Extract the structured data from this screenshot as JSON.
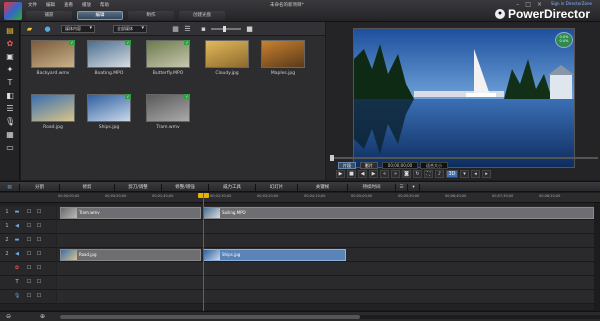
{
  "window": {
    "title": "未命名的新项目*",
    "menu": [
      "文件",
      "编辑",
      "查看",
      "播放",
      "帮助"
    ],
    "brand": "PowerDirector",
    "director_zone": "Sign in DirectorZone",
    "tabs": [
      "捕获",
      "编辑",
      "制作",
      "创建光盘"
    ],
    "active_tab": "编辑"
  },
  "library": {
    "filter_dropdown": "媒体内容",
    "sort_dropdown": "全部媒体",
    "items": [
      {
        "label": "Backyard.wmv",
        "colors": [
          "#7a5a3a",
          "#c9b28a"
        ],
        "checked": true
      },
      {
        "label": "Boating.MPO",
        "colors": [
          "#4b6e8e",
          "#d7dde4"
        ],
        "checked": true
      },
      {
        "label": "Butterfly.MPO",
        "colors": [
          "#6b7b4a",
          "#c9c7b2"
        ],
        "checked": true
      },
      {
        "label": "Cloudy.jpg",
        "colors": [
          "#e2b95a",
          "#8c6a2e"
        ],
        "checked": false
      },
      {
        "label": "Maples.jpg",
        "colors": [
          "#c9812e",
          "#5a3a1a"
        ],
        "checked": false
      },
      {
        "label": "Road.jpg",
        "colors": [
          "#3a6fb0",
          "#d8c48a"
        ],
        "checked": false
      },
      {
        "label": "Ships.jpg",
        "colors": [
          "#2f5f9f",
          "#c8d8ea"
        ],
        "checked": true
      },
      {
        "label": "Tram.wmv",
        "colors": [
          "#5a5a5a",
          "#aaaaaa"
        ],
        "checked": true
      }
    ]
  },
  "preview": {
    "btn_clip": "片段",
    "btn_movie": "影片",
    "timecode_1": "00;00;00;00",
    "timecode_2": "00;00;00;00",
    "size_dropdown": "适合大小",
    "usage_line1": "0.0%",
    "usage_line2": "0.0%",
    "transport": [
      "▶",
      "■",
      "◀◀",
      "◀",
      "▶",
      "▶▶",
      "⧉",
      "◎",
      "🔊",
      "3D",
      "◀",
      "▶"
    ]
  },
  "timeline": {
    "tools": [
      "分割",
      "修剪",
      "剪刀/调整",
      "修整/增强",
      "威力工具",
      "幻灯片",
      "关键帧",
      "持续时间"
    ],
    "ruler": [
      "00;00;00;00",
      "00;00;50;00",
      "00;01;40;00",
      "00;02;30;00",
      "00;03;20;00",
      "00;04;10;00",
      "00;05;00;00",
      "00;05;50;00",
      "00;06;40;00",
      "00;07;30;00",
      "00;08;20;00"
    ],
    "clips": [
      {
        "label": "Tram.wmv",
        "track": 0,
        "kind": "video"
      },
      {
        "label": "Sailing.MPO",
        "track": 0,
        "kind": "video"
      },
      {
        "label": "Road.jpg",
        "track": 3,
        "kind": "video"
      },
      {
        "label": "Ships.jpg",
        "track": 3,
        "kind": "blue"
      }
    ]
  }
}
